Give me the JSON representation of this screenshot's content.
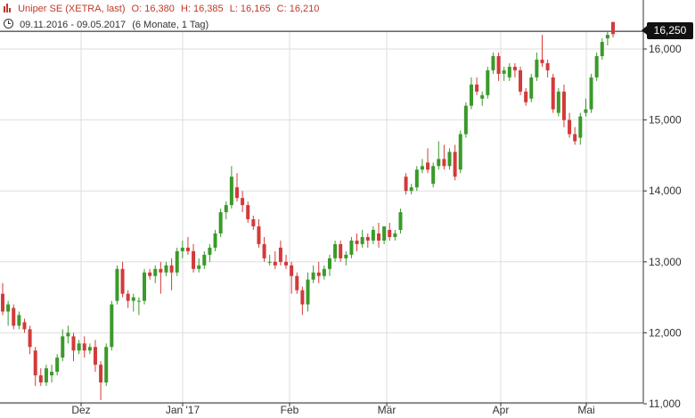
{
  "header": {
    "title": "Uniper SE (XETRA, last)",
    "open": "O: 16,380",
    "high": "H: 16,385",
    "low": "L: 16,165",
    "close": "C: 16,210",
    "range": "09.11.2016 - 09.05.2017",
    "period": "(6 Monate, 1 Tag)",
    "icon": "candlestick-icon",
    "range_icon": "clock-icon"
  },
  "last_price_label": "16,250",
  "colors": {
    "up": "#3a9a2a",
    "down": "#d33a3a",
    "grid": "#dddddd",
    "axis": "#333333",
    "last_line": "#111111"
  },
  "chart_data": {
    "type": "candlestick",
    "title": "Uniper SE (XETRA, last)",
    "xlabel": "",
    "ylabel": "",
    "x_tick_labels": [
      "Dez",
      "Jan '17",
      "Feb",
      "Mär",
      "Apr",
      "Mai"
    ],
    "y_ticks": [
      11.0,
      12.0,
      13.0,
      14.0,
      15.0,
      16.0
    ],
    "y_tick_labels": [
      "11,000",
      "12,000",
      "13,000",
      "14,000",
      "15,000",
      "16,000"
    ],
    "ylim": [
      10.8,
      16.3
    ],
    "last_price": 16.25,
    "grid": true,
    "ohlc": [
      [
        12.55,
        12.7,
        12.25,
        12.3
      ],
      [
        12.3,
        12.45,
        12.1,
        12.4
      ],
      [
        12.35,
        12.4,
        12.05,
        12.1
      ],
      [
        12.1,
        12.3,
        12.05,
        12.25
      ],
      [
        12.15,
        12.2,
        12.0,
        12.05
      ],
      [
        12.05,
        12.1,
        11.7,
        11.8
      ],
      [
        11.75,
        11.8,
        11.25,
        11.4
      ],
      [
        11.4,
        11.5,
        11.25,
        11.3
      ],
      [
        11.3,
        11.55,
        11.25,
        11.5
      ],
      [
        11.4,
        11.55,
        11.3,
        11.45
      ],
      [
        11.45,
        11.7,
        11.4,
        11.65
      ],
      [
        11.65,
        12.05,
        11.6,
        11.95
      ],
      [
        11.95,
        12.1,
        11.85,
        12.0
      ],
      [
        11.95,
        12.0,
        11.6,
        11.75
      ],
      [
        11.75,
        11.9,
        11.7,
        11.85
      ],
      [
        11.85,
        11.95,
        11.65,
        11.75
      ],
      [
        11.75,
        11.85,
        11.7,
        11.8
      ],
      [
        11.8,
        11.9,
        11.45,
        11.55
      ],
      [
        11.55,
        11.6,
        11.05,
        11.3
      ],
      [
        11.3,
        11.85,
        11.25,
        11.8
      ],
      [
        11.8,
        12.45,
        11.75,
        12.4
      ],
      [
        12.45,
        12.95,
        12.4,
        12.9
      ],
      [
        12.9,
        13.0,
        12.5,
        12.55
      ],
      [
        12.55,
        12.6,
        12.35,
        12.45
      ],
      [
        12.45,
        12.55,
        12.3,
        12.5
      ],
      [
        12.45,
        12.5,
        12.25,
        12.45
      ],
      [
        12.45,
        12.9,
        12.4,
        12.85
      ],
      [
        12.85,
        12.9,
        12.75,
        12.8
      ],
      [
        12.8,
        12.95,
        12.7,
        12.9
      ],
      [
        12.9,
        13.0,
        12.55,
        12.85
      ],
      [
        12.85,
        13.0,
        12.8,
        12.95
      ],
      [
        12.95,
        13.05,
        12.6,
        12.85
      ],
      [
        12.85,
        13.2,
        12.8,
        13.15
      ],
      [
        13.15,
        13.3,
        13.05,
        13.2
      ],
      [
        13.2,
        13.35,
        13.1,
        13.15
      ],
      [
        13.15,
        13.25,
        12.85,
        12.9
      ],
      [
        12.9,
        13.05,
        12.85,
        12.95
      ],
      [
        12.95,
        13.15,
        12.9,
        13.1
      ],
      [
        13.1,
        13.25,
        13.0,
        13.2
      ],
      [
        13.2,
        13.45,
        13.15,
        13.4
      ],
      [
        13.4,
        13.75,
        13.35,
        13.7
      ],
      [
        13.7,
        13.85,
        13.6,
        13.8
      ],
      [
        13.8,
        14.35,
        13.75,
        14.2
      ],
      [
        14.05,
        14.25,
        13.85,
        13.9
      ],
      [
        13.9,
        14.0,
        13.7,
        13.8
      ],
      [
        13.8,
        13.85,
        13.55,
        13.6
      ],
      [
        13.6,
        13.65,
        13.45,
        13.5
      ],
      [
        13.5,
        13.6,
        13.2,
        13.25
      ],
      [
        13.25,
        13.35,
        13.0,
        13.05
      ],
      [
        13.0,
        13.1,
        12.95,
        13.0
      ],
      [
        13.0,
        13.15,
        12.9,
        12.95
      ],
      [
        13.2,
        13.3,
        12.95,
        13.0
      ],
      [
        13.0,
        13.1,
        12.9,
        12.95
      ],
      [
        12.95,
        13.0,
        12.55,
        12.8
      ],
      [
        12.8,
        12.85,
        12.55,
        12.6
      ],
      [
        12.6,
        12.65,
        12.25,
        12.4
      ],
      [
        12.4,
        12.85,
        12.3,
        12.75
      ],
      [
        12.75,
        12.95,
        12.7,
        12.85
      ],
      [
        12.85,
        13.0,
        12.7,
        12.8
      ],
      [
        12.8,
        12.95,
        12.75,
        12.9
      ],
      [
        12.9,
        13.1,
        12.8,
        13.05
      ],
      [
        13.05,
        13.3,
        13.0,
        13.25
      ],
      [
        13.25,
        13.3,
        13.0,
        13.05
      ],
      [
        13.05,
        13.15,
        12.95,
        13.1
      ],
      [
        13.1,
        13.35,
        13.05,
        13.3
      ],
      [
        13.3,
        13.4,
        13.15,
        13.25
      ],
      [
        13.25,
        13.45,
        13.2,
        13.35
      ],
      [
        13.35,
        13.4,
        13.2,
        13.3
      ],
      [
        13.3,
        13.5,
        13.25,
        13.45
      ],
      [
        13.4,
        13.55,
        13.2,
        13.3
      ],
      [
        13.3,
        13.5,
        13.25,
        13.5
      ],
      [
        13.45,
        13.55,
        13.3,
        13.35
      ],
      [
        13.35,
        13.45,
        13.3,
        13.4
      ],
      [
        13.45,
        13.75,
        13.4,
        13.7
      ],
      [
        14.2,
        14.25,
        13.95,
        14.0
      ],
      [
        14.0,
        14.1,
        13.95,
        14.05
      ],
      [
        14.05,
        14.35,
        14.0,
        14.3
      ],
      [
        14.3,
        14.45,
        14.25,
        14.35
      ],
      [
        14.4,
        14.6,
        14.25,
        14.3
      ],
      [
        14.1,
        14.4,
        14.05,
        14.35
      ],
      [
        14.35,
        14.7,
        14.3,
        14.45
      ],
      [
        14.45,
        14.65,
        14.3,
        14.35
      ],
      [
        14.35,
        14.6,
        14.3,
        14.55
      ],
      [
        14.55,
        14.65,
        14.15,
        14.2
      ],
      [
        14.3,
        14.85,
        14.25,
        14.8
      ],
      [
        14.8,
        15.25,
        14.75,
        15.2
      ],
      [
        15.2,
        15.6,
        15.15,
        15.5
      ],
      [
        15.5,
        15.6,
        15.35,
        15.4
      ],
      [
        15.3,
        15.4,
        15.2,
        15.35
      ],
      [
        15.35,
        15.75,
        15.3,
        15.7
      ],
      [
        15.7,
        15.95,
        15.65,
        15.9
      ],
      [
        15.9,
        15.95,
        15.55,
        15.65
      ],
      [
        15.65,
        15.75,
        15.55,
        15.7
      ],
      [
        15.6,
        15.8,
        15.55,
        15.75
      ],
      [
        15.75,
        15.8,
        15.6,
        15.7
      ],
      [
        15.7,
        15.75,
        15.35,
        15.4
      ],
      [
        15.4,
        15.45,
        15.2,
        15.25
      ],
      [
        15.3,
        15.65,
        15.25,
        15.6
      ],
      [
        15.6,
        15.95,
        15.55,
        15.85
      ],
      [
        15.85,
        16.2,
        15.75,
        15.8
      ],
      [
        15.8,
        15.85,
        15.6,
        15.7
      ],
      [
        15.6,
        15.65,
        15.1,
        15.15
      ],
      [
        15.1,
        15.45,
        15.05,
        15.4
      ],
      [
        15.4,
        15.5,
        14.9,
        15.0
      ],
      [
        15.0,
        15.1,
        14.75,
        14.8
      ],
      [
        14.8,
        14.9,
        14.65,
        14.7
      ],
      [
        14.75,
        15.1,
        14.65,
        15.05
      ],
      [
        15.1,
        15.3,
        15.05,
        15.15
      ],
      [
        15.15,
        15.65,
        15.1,
        15.6
      ],
      [
        15.6,
        15.95,
        15.55,
        15.9
      ],
      [
        15.9,
        16.15,
        15.85,
        16.1
      ],
      [
        16.15,
        16.25,
        16.05,
        16.2
      ],
      [
        16.38,
        16.385,
        16.165,
        16.21
      ]
    ]
  }
}
